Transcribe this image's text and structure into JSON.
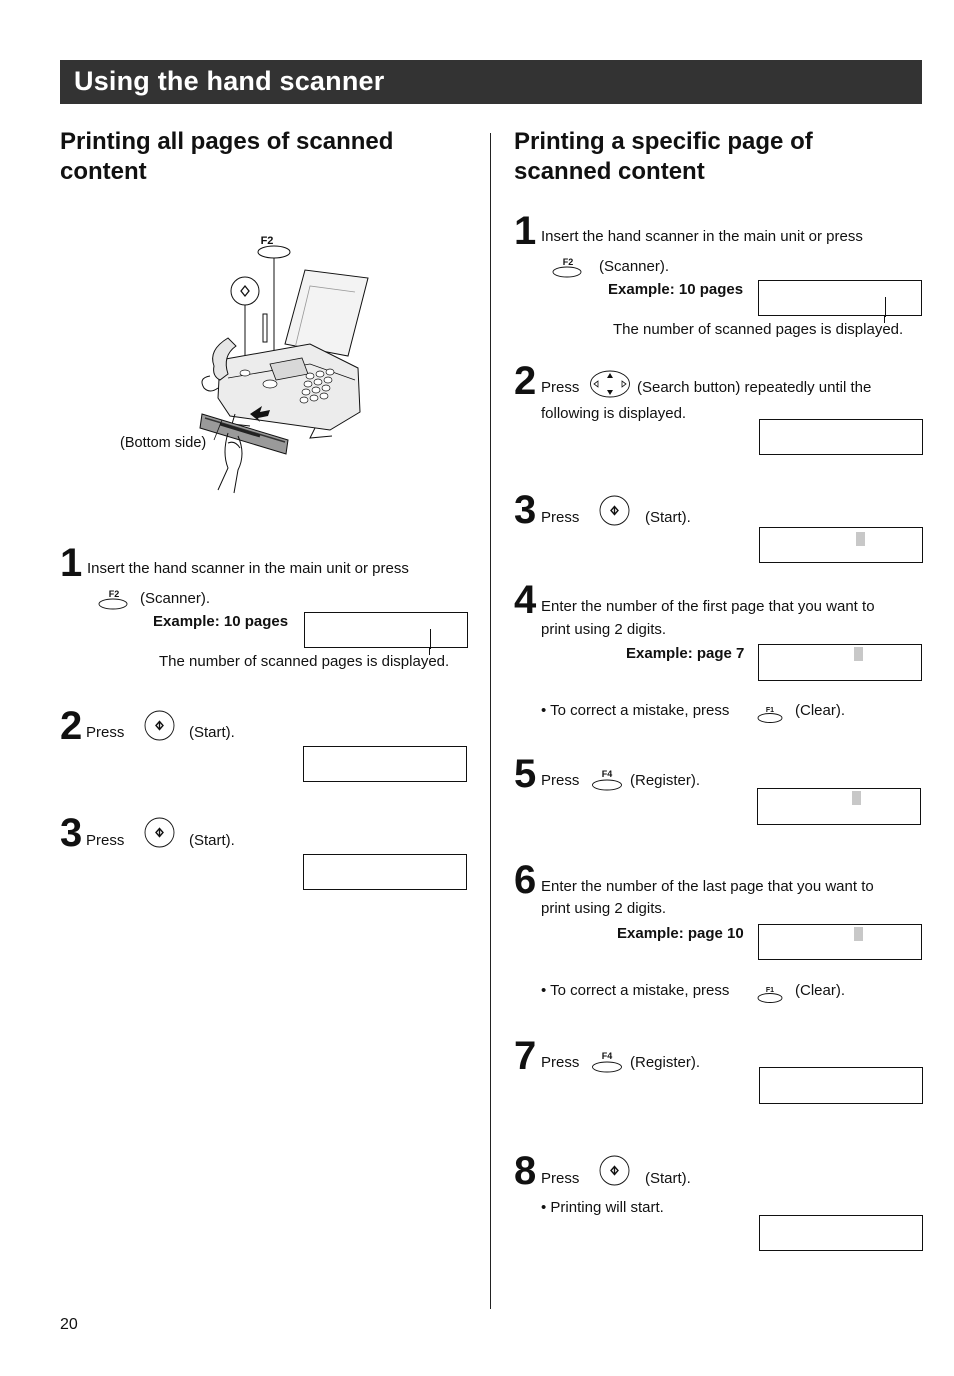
{
  "header": {
    "title": "Using the hand scanner"
  },
  "left_section": {
    "title_line1": "Printing all pages of scanned",
    "title_line2": "content",
    "illustration": {
      "key_label": "F2",
      "caption": "(Bottom side)",
      "icons": [
        "start-key-icon",
        "f2-key-icon",
        "fax-machine-illustration",
        "hand-scanner-illustration"
      ]
    },
    "steps": [
      {
        "number": "1",
        "text": "Insert the hand scanner in the main unit or press",
        "key_label": "F2",
        "key_text": "(Scanner).",
        "example": "Example: 10 pages",
        "note": "The number of scanned pages is displayed."
      },
      {
        "number": "2",
        "press": "Press",
        "key_text": "(Start)."
      },
      {
        "number": "3",
        "press": "Press",
        "key_text": "(Start)."
      }
    ]
  },
  "right_section": {
    "title_line1": "Printing a specific page of",
    "title_line2": "scanned content",
    "steps": [
      {
        "number": "1",
        "text": "Insert the hand scanner in the main unit or press",
        "key_label": "F2",
        "key_text": "(Scanner).",
        "example": "Example: 10 pages",
        "note": "The number of scanned pages is displayed."
      },
      {
        "number": "2",
        "press": "Press",
        "key_text": "(Search button) repeatedly until the",
        "text_line2": "following is displayed."
      },
      {
        "number": "3",
        "press": "Press",
        "key_text": "(Start)."
      },
      {
        "number": "4",
        "text": "Enter the number of the first page that you want to",
        "text_line2": "print using 2 digits.",
        "example": "Example: page 7",
        "bullet": "To correct a mistake, press",
        "bullet_key": "F1",
        "bullet_key_text": "(Clear)."
      },
      {
        "number": "5",
        "press": "Press",
        "key_label": "F4",
        "key_text": "(Register)."
      },
      {
        "number": "6",
        "text": "Enter the number of the last page that you want to",
        "text_line2": "print using 2 digits.",
        "example": "Example: page 10",
        "bullet": "To correct a mistake, press",
        "bullet_key": "F1",
        "bullet_key_text": "(Clear)."
      },
      {
        "number": "7",
        "press": "Press",
        "key_label": "F4",
        "key_text": "(Register)."
      },
      {
        "number": "8",
        "press": "Press",
        "key_text": "(Start).",
        "bullet": "Printing will start."
      }
    ]
  },
  "footer": {
    "page_number": "20"
  }
}
